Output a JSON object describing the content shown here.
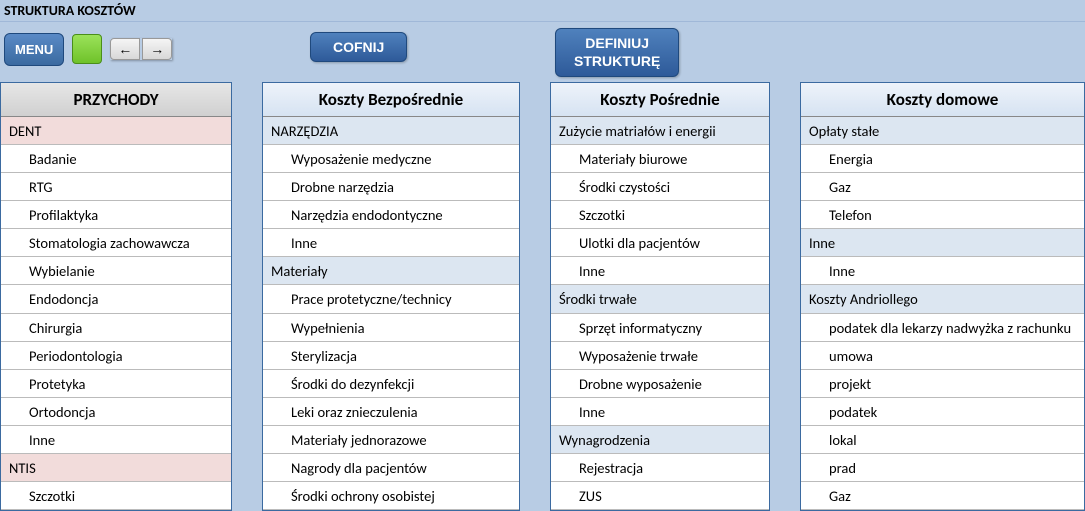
{
  "title": "STRUKTURA KOSZTÓW",
  "toolbar": {
    "menu": "MENU",
    "cofnij": "COFNIJ",
    "definiuj": "DEFINIUJ\nSTRUKTURĘ"
  },
  "columns": [
    {
      "header": "PRZYCHODY",
      "rows": [
        {
          "text": "DENT",
          "type": "section"
        },
        {
          "text": "Badanie",
          "type": "indent"
        },
        {
          "text": "RTG",
          "type": "indent"
        },
        {
          "text": "Profilaktyka",
          "type": "indent"
        },
        {
          "text": "Stomatologia zachowawcza",
          "type": "indent"
        },
        {
          "text": "Wybielanie",
          "type": "indent"
        },
        {
          "text": "Endodoncja",
          "type": "indent"
        },
        {
          "text": "Chirurgia",
          "type": "indent"
        },
        {
          "text": "Periodontologia",
          "type": "indent"
        },
        {
          "text": "Protetyka",
          "type": "indent"
        },
        {
          "text": "Ortodoncja",
          "type": "indent"
        },
        {
          "text": "Inne",
          "type": "indent"
        },
        {
          "text": "NTIS",
          "type": "section"
        },
        {
          "text": "Szczotki",
          "type": "indent"
        }
      ]
    },
    {
      "header": "Koszty Bezpośrednie",
      "rows": [
        {
          "text": "NARZĘDZIA",
          "type": "bluehead"
        },
        {
          "text": "Wyposażenie medyczne",
          "type": "indent"
        },
        {
          "text": "Drobne narzędzia",
          "type": "indent"
        },
        {
          "text": "Narzędzia endodontyczne",
          "type": "indent"
        },
        {
          "text": "Inne",
          "type": "indent"
        },
        {
          "text": "Materiały",
          "type": "bluehead"
        },
        {
          "text": "Prace protetyczne/technicy",
          "type": "indent"
        },
        {
          "text": "Wypełnienia",
          "type": "indent"
        },
        {
          "text": "Sterylizacja",
          "type": "indent"
        },
        {
          "text": "Środki do dezynfekcji",
          "type": "indent"
        },
        {
          "text": "Leki oraz znieczulenia",
          "type": "indent"
        },
        {
          "text": "Materiały jednorazowe",
          "type": "indent"
        },
        {
          "text": "Nagrody dla pacjentów",
          "type": "indent"
        },
        {
          "text": "Środki ochrony osobistej",
          "type": "indent"
        }
      ]
    },
    {
      "header": "Koszty Pośrednie",
      "rows": [
        {
          "text": "Zużycie matriałów i energii",
          "type": "bluehead"
        },
        {
          "text": "Materiały biurowe",
          "type": "indent"
        },
        {
          "text": "Środki czystości",
          "type": "indent"
        },
        {
          "text": "Szczotki",
          "type": "indent"
        },
        {
          "text": "Ulotki dla pacjentów",
          "type": "indent"
        },
        {
          "text": "Inne",
          "type": "indent"
        },
        {
          "text": "Środki trwałe",
          "type": "bluehead"
        },
        {
          "text": "Sprzęt informatyczny",
          "type": "indent"
        },
        {
          "text": "Wyposażenie trwałe",
          "type": "indent"
        },
        {
          "text": "Drobne wyposażenie",
          "type": "indent"
        },
        {
          "text": "Inne",
          "type": "indent"
        },
        {
          "text": "Wynagrodzenia",
          "type": "bluehead"
        },
        {
          "text": "Rejestracja",
          "type": "indent"
        },
        {
          "text": "ZUS",
          "type": "indent"
        }
      ]
    },
    {
      "header": "Koszty domowe",
      "rows": [
        {
          "text": "Opłaty stałe",
          "type": "bluehead"
        },
        {
          "text": "Energia",
          "type": "indent"
        },
        {
          "text": "Gaz",
          "type": "indent"
        },
        {
          "text": "Telefon",
          "type": "indent"
        },
        {
          "text": "Inne",
          "type": "bluehead"
        },
        {
          "text": "Inne",
          "type": "indent"
        },
        {
          "text": "Koszty Andriollego",
          "type": "bluehead"
        },
        {
          "text": "podatek dla lekarzy nadwyżka z rachunku",
          "type": "indent"
        },
        {
          "text": "umowa",
          "type": "indent"
        },
        {
          "text": "projekt",
          "type": "indent"
        },
        {
          "text": "podatek",
          "type": "indent"
        },
        {
          "text": "lokal",
          "type": "indent"
        },
        {
          "text": "prad",
          "type": "indent"
        },
        {
          "text": "Gaz",
          "type": "indent"
        }
      ]
    }
  ]
}
